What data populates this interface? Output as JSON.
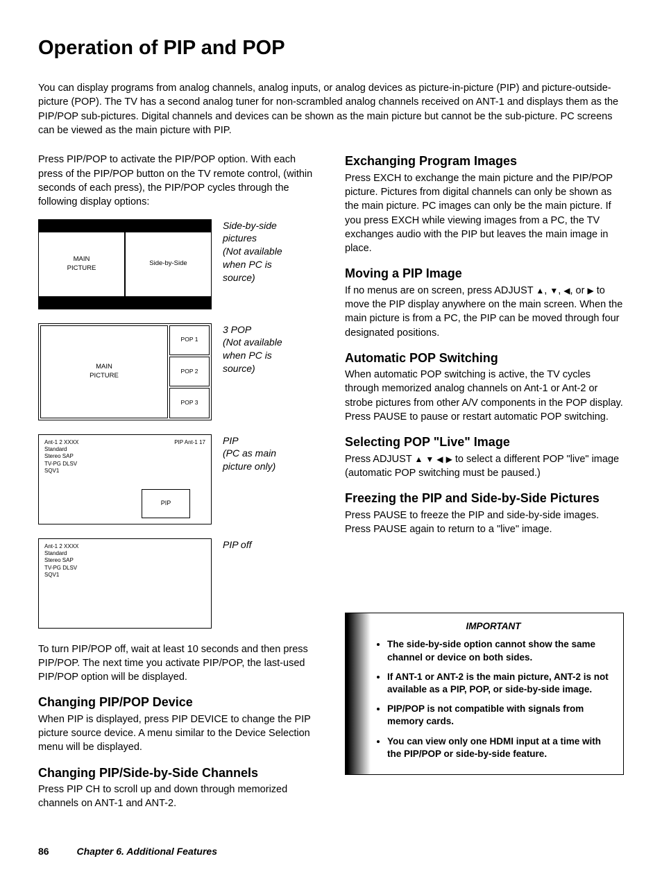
{
  "title": "Operation of PIP and POP",
  "intro": "You can display programs from analog channels, analog inputs, or analog devices as picture-in-picture (PIP) and picture-outside-picture (POP).  The TV has a second analog tuner for non-scrambled analog channels received on ANT-1 and  displays them as the PIP/POP sub-pictures.  Digital channels and devices can be shown as the main picture but cannot be the sub-picture.  PC screens can be viewed as the main picture with PIP.",
  "left": {
    "p1": "Press PIP/POP to activate the PIP/POP option.  With each press of the PIP/POP button on the TV remote control, (within seconds of each press), the PIP/POP cycles through the following display options:",
    "d1": {
      "main": "MAIN\nPICTURE",
      "side": "Side-by-Side",
      "caption": "Side-by-side pictures\n(Not available when PC is source)"
    },
    "d2": {
      "main": "MAIN\nPICTURE",
      "pop1": "POP 1",
      "pop2": "POP 2",
      "pop3": "POP 3",
      "caption": "3 POP\n(Not available when PC is source)"
    },
    "d3": {
      "lines": "Ant-1 2 XXXX\nStandard\nStereo SAP\nTV-PG DLSV\nSQV1",
      "right": "PIP Ant-1  17",
      "pip": "PIP",
      "caption": "PIP\n(PC as main picture only)"
    },
    "d4": {
      "lines": "Ant-1 2 XXXX\nStandard\nStereo SAP\nTV-PG DLSV\nSQV1",
      "caption": "PIP off"
    },
    "p2": "To turn PIP/POP off, wait at least 10 seconds and then press PIP/POP.  The next time you activate PIP/POP, the last-used PIP/POP option will be displayed.",
    "h1": "Changing PIP/POP Device",
    "p3": "When PIP is displayed, press PIP DEVICE to change the PIP picture source device.  A menu similar to the Device Selection menu will be displayed.",
    "h2": "Changing PIP/Side-by-Side Channels",
    "p4": "Press PIP CH to scroll up and down through memorized channels on ANT-1 and ANT-2."
  },
  "right": {
    "h1": "Exchanging Program Images",
    "p1": "Press EXCH to exchange the main picture and the PIP/POP picture.  Pictures from digital channels can only be shown as the main picture.  PC images can only be the main picture.  If you press EXCH while viewing images from a PC, the TV exchanges audio with the PIP but leaves the main image in place.",
    "h2": "Moving a PIP Image",
    "p2a": "If no menus are on screen, press ADJUST ",
    "p2b": " to move the PIP display anywhere on the main screen.  When the main picture is from a PC, the PIP can be moved through four designated positions.",
    "h3": "Automatic POP Switching",
    "p3": "When automatic POP switching is active, the TV cycles through memorized analog channels on Ant-1 or Ant-2 or strobe pictures from other A/V components in the POP display.  Press PAUSE to pause or restart automatic POP switching.",
    "h4": "Selecting POP \"Live\" Image",
    "p4a": "Press ADJUST ",
    "p4b": " to select a different POP \"live\" image (automatic POP switching must be paused.)",
    "h5": "Freezing the PIP and Side-by-Side Pictures",
    "p5": "Press PAUSE to freeze the PIP and side-by-side images.  Press PAUSE again to return to a \"live\" image."
  },
  "important": {
    "title": "IMPORTANT",
    "items": [
      "The side-by-side option cannot show the same channel or device on both sides.",
      "If ANT-1 or ANT-2 is the main picture, ANT-2 is not available as a PIP, POP, or side-by-side image.",
      "PIP/POP is not compatible with signals from memory cards.",
      "You can view only one HDMI input at a time with the PIP/POP or side-by-side feature."
    ]
  },
  "footer": {
    "page": "86",
    "chapter": "Chapter 6. Additional Features"
  }
}
